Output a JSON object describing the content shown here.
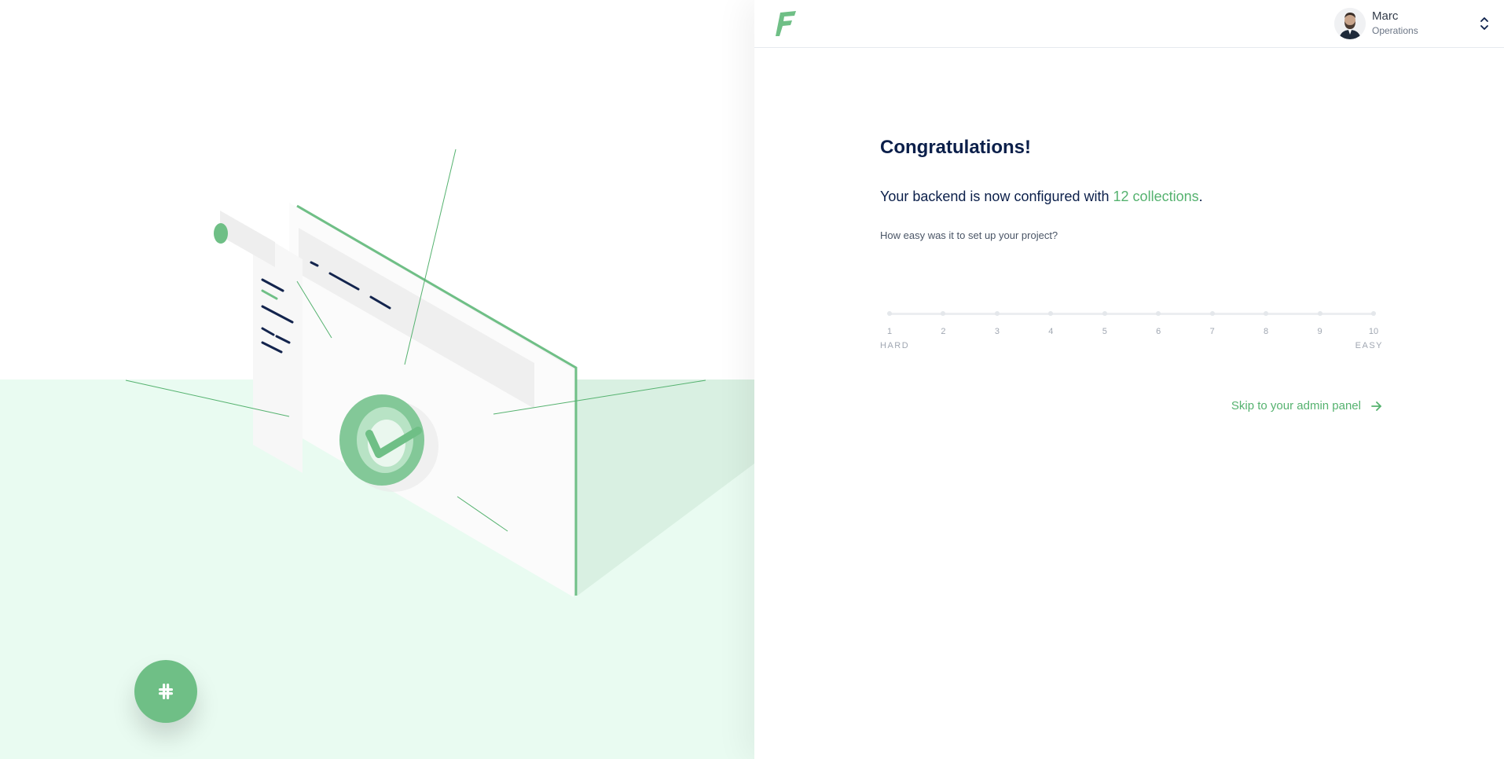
{
  "colors": {
    "accent": "#55b26f",
    "text": "#0b1f4a",
    "floor": "#e9fbf1",
    "slack_button": "#6fbf86"
  },
  "header": {
    "logo_icon": "f-logo-icon",
    "user": {
      "name": "Marc",
      "role": "Operations",
      "avatar_icon": "user-avatar",
      "toggle_icon": "chevron-up-down-icon"
    }
  },
  "main": {
    "title": "Congratulations!",
    "config": {
      "prefix": "Your backend is now configured with ",
      "highlight": "12 collections",
      "suffix": "."
    },
    "question": "How easy was it to set up your project?",
    "rating": {
      "options": [
        "1",
        "2",
        "3",
        "4",
        "5",
        "6",
        "7",
        "8",
        "9",
        "10"
      ],
      "min_label": "HARD",
      "max_label": "EASY"
    },
    "skip_label": "Skip to your admin panel",
    "skip_icon": "arrow-right-icon"
  },
  "illustration": {
    "icon": "success-check-illustration"
  },
  "chat": {
    "icon": "slack-icon"
  }
}
